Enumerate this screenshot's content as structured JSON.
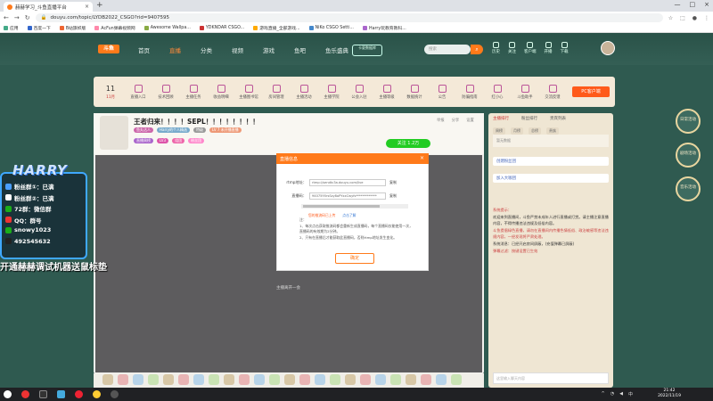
{
  "browser": {
    "tab_title": "赫赫学习_斗鱼直播平台",
    "url": "douyu.com/topic/LYDB2022_CSGO?rid=9407595",
    "bookmarks": [
      "应用",
      "百度一下",
      "B站旗帜版",
      "AcFun弹幕视频网",
      "Awesome Wallpa...",
      "YDKNDAR CSGO...",
      "游戏直播_全部游戏...",
      "NiKo CSGO Setti...",
      "Harry玩教育教科..."
    ]
  },
  "site": {
    "logo": "斗鱼",
    "nav": [
      "首页",
      "直播",
      "分类",
      "视频",
      "游戏",
      "鱼吧",
      "鱼乐盛典"
    ],
    "active_nav": "直播",
    "badge": "卡夏数据库",
    "search_placeholder": "搜索",
    "tools": [
      "历史",
      "关注",
      "客户端",
      "开播",
      "下载"
    ]
  },
  "categories": {
    "day": "11",
    "month": "11月",
    "items": [
      "直播入口",
      "技术回顾",
      "主播任务",
      "收益明细",
      "主播图书馆",
      "房间管理",
      "主播活动",
      "主播学院",
      "公会入驻",
      "主播等级",
      "数据统计",
      "公告",
      "防骗指南",
      "红小心",
      "斗鱼助手",
      "交流反馈",
      "更多"
    ],
    "pc_button": "PC客户端"
  },
  "stream": {
    "title": "王者归来！！！！SEPL！！！！！！！！",
    "meta": [
      "房间",
      "Harry的直播间",
      "分享",
      "举报"
    ],
    "tags": [
      "鱼丸达人",
      "Harry的个人精选",
      "特级",
      "LV 7 未开播直播"
    ],
    "tags2": [
      "直播周榜",
      "LV3",
      "组团",
      "粉丝团"
    ],
    "follow_label": "关注 1.2万",
    "right_meta": [
      "举报",
      "分享",
      "设置"
    ],
    "video_caption": "主播离开一会"
  },
  "modal": {
    "title": "直播信息",
    "rtmp_label": "rtmp地址：",
    "rtmp_value": "rtmp://sendtc3a.douyu.com/live",
    "key_label": "直播码：",
    "key_value": "9407595rsSzy8oPYxxCwyfs*************",
    "copy": "复制",
    "link1": "您的推流码已上传",
    "link2": "点击了解",
    "note_lines": [
      "注：",
      "1、每次点击获取推流码都会重新生成直播码，每个直播码仅能使用一次，",
      "直播码的有效期为2分钟。",
      "2、只有在直播后才能获取此直播码，否则rtmp地址发生变化。"
    ],
    "confirm": "确定"
  },
  "chat": {
    "tabs": [
      "主播排行",
      "粉丝排行",
      "贵宾列表"
    ],
    "sub_tabs": [
      "周榜",
      "月榜",
      "总榜",
      "贵族"
    ],
    "rank_placeholder": "暂无数据",
    "cards": [
      "创建粉丝团",
      "加入大咖团"
    ],
    "system_lines": [
      "系统提示：",
      "欢迎来到直播间，斗鱼严禁未成年人进行直播或打赏。请主播注意直播内容，不得传播违法违规及低俗内容。",
      "斗鱼提倡绿色直播，请勿在直播间内传播色情低俗、政治敏感等违法违规内容，一经发现将严肃处理。",
      "系统消息：已经开启房间屏蔽，(充值弹幕已屏蔽)",
      "弹幕过滤：按键设置已生效"
    ],
    "input_placeholder": "这里输入聊天内容"
  },
  "right_badges": [
    "日常活动",
    "剧场活动",
    "音乐活动"
  ],
  "overlay": {
    "brand": "HARRY",
    "lines": [
      "粉丝群①：已满",
      "粉丝群②：已满",
      "72群：微信群",
      "QQ：群号",
      "snowy1023",
      "492545632"
    ],
    "big_text": "开通赫赫调试机器送鼠标垫"
  },
  "taskbar": {
    "time": "21:42",
    "date": "2022/11/19"
  },
  "colors": {
    "accent": "#ff7a1a",
    "site_bg": "#2f5a50",
    "overlay_border": "#3fa8ff"
  }
}
